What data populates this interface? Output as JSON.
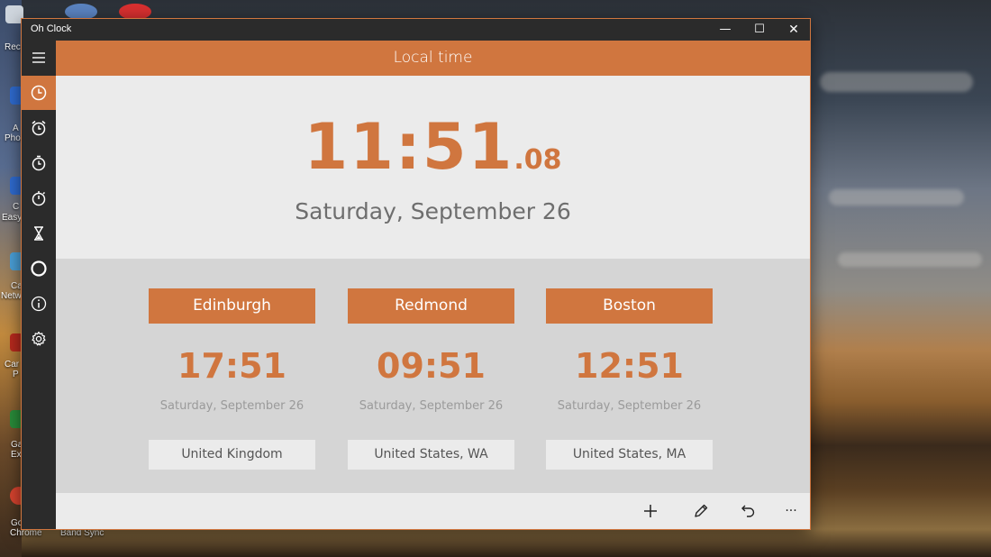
{
  "desktop": {
    "icon_labels": [
      "Recy",
      "A",
      "Phot",
      "C",
      "Easy",
      "Ca",
      "Netw",
      "Car",
      "P",
      "Ga",
      "Ex",
      "Go",
      "Chrome",
      "Band Sync"
    ]
  },
  "window": {
    "title": "Oh Clock",
    "minimize_glyph": "—",
    "maximize_glyph": "☐",
    "close_glyph": "✕"
  },
  "sidebar": {
    "items": [
      {
        "icon": "hamburger-menu-icon"
      },
      {
        "icon": "clock-icon",
        "active": true
      },
      {
        "icon": "alarm-icon"
      },
      {
        "icon": "timer-icon"
      },
      {
        "icon": "stopwatch-icon"
      },
      {
        "icon": "hourglass-icon"
      },
      {
        "icon": "circle-icon"
      },
      {
        "icon": "info-icon"
      },
      {
        "icon": "gear-icon"
      }
    ]
  },
  "header": {
    "title": "Local time"
  },
  "local": {
    "time_hm": "11:51",
    "time_sec": ".08",
    "date": "Saturday, September 26"
  },
  "cities": [
    {
      "city": "Edinburgh",
      "time": "17:51",
      "date": "Saturday, September 26",
      "country": "United Kingdom"
    },
    {
      "city": "Redmond",
      "time": "09:51",
      "date": "Saturday, September 26",
      "country": "United States, WA"
    },
    {
      "city": "Boston",
      "time": "12:51",
      "date": "Saturday, September 26",
      "country": "United States, MA"
    }
  ],
  "appbar": {
    "buttons": [
      "add-icon",
      "pencil-icon",
      "undo-icon",
      "more-icon"
    ],
    "more_glyph": "···"
  },
  "colors": {
    "accent": "#d0763f",
    "sidebar": "#2b2b2b",
    "panel": "#ebebeb",
    "world_bg": "#d5d5d5"
  }
}
